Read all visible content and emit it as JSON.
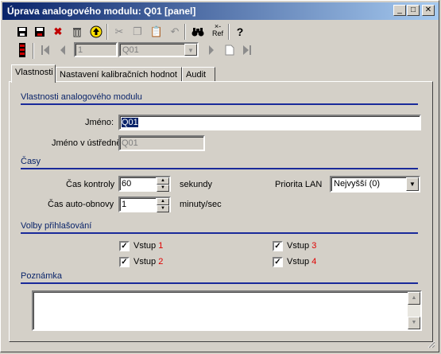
{
  "window": {
    "title": "Úprava analogového modulu: Q01 [panel]",
    "min": "_",
    "max": "□",
    "close": "✕"
  },
  "toolbar": {
    "record_field": "1",
    "record_combo": "Q01"
  },
  "tabs": [
    "Vlastnosti",
    "Nastavení kalibračních hodnot",
    "Audit"
  ],
  "sections": {
    "props": "Vlastnosti analogového modulu",
    "times": "Časy",
    "login": "Volby přihlašování",
    "note": "Poznámka"
  },
  "form": {
    "name_label": "Jméno:",
    "name_value": "Q01",
    "central_name_label": "Jméno v ústředně:",
    "central_name_value": "Q01",
    "control_time_label": "Čas kontroly",
    "control_time_value": "60",
    "control_time_unit": "sekundy",
    "refresh_label": "Čas auto-obnovy",
    "refresh_value": "1",
    "refresh_unit": "minuty/sec",
    "lan_label": "Priorita LAN",
    "lan_value": "Nejvyšší (0)"
  },
  "inputs": [
    {
      "text": "Vstup",
      "num": "1",
      "checked": true
    },
    {
      "text": "Vstup",
      "num": "2",
      "checked": true
    },
    {
      "text": "Vstup",
      "num": "3",
      "checked": true
    },
    {
      "text": "Vstup",
      "num": "4",
      "checked": true
    }
  ],
  "toolbar_icons": {
    "save": "save-icon",
    "save_all": "save-all-icon",
    "delete": "delete-icon",
    "trash": "trash-icon",
    "up": "up-arrow-icon",
    "ref": "Ref",
    "ref_top": "×-",
    "help": "?"
  },
  "colors": {
    "titlebar_start": "#0a246a",
    "titlebar_end": "#a6caf0",
    "section_text": "#0a246a",
    "input_number": "#e00000"
  }
}
